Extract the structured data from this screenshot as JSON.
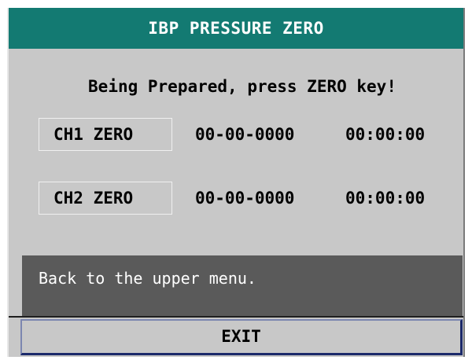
{
  "window": {
    "title": "IBP PRESSURE ZERO"
  },
  "status": {
    "message": "Being Prepared, press ZERO key!"
  },
  "channels": [
    {
      "button_label": "CH1 ZERO",
      "date": "00-00-0000",
      "time": "00:00:00"
    },
    {
      "button_label": "CH2 ZERO",
      "date": "00-00-0000",
      "time": "00:00:00"
    }
  ],
  "help": {
    "text": "Back to the upper menu."
  },
  "footer": {
    "exit_label": "EXIT"
  },
  "colors": {
    "title_bar": "#137a72",
    "background": "#c8c8c8",
    "help_panel": "#5a5a5a",
    "exit_border": "#1c2a6a"
  }
}
